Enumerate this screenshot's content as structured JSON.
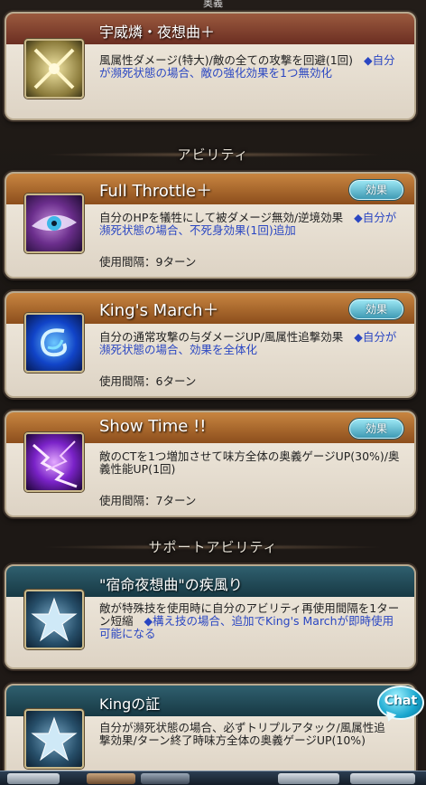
{
  "top_header": {
    "label": "奥義"
  },
  "ougi": {
    "title": "宇威燐・夜想曲＋",
    "icon": "crossed-swords-icon",
    "desc": "風属性ダメージ(特大)/敵の全ての攻撃を回避(1回)",
    "desc_hl": "◆自分が瀕死状態の場合、敵の強化効果を1つ無効化"
  },
  "ability_header": {
    "label": "アビリティ"
  },
  "abilities": [
    {
      "title": "Full Throttle＋",
      "icon": "eye-icon",
      "effect_label": "効果",
      "desc": "自分のHPを犠牲にして被ダメージ無効/逆境効果",
      "desc_hl": "◆自分が瀕死状態の場合、不死身効果(1回)追加",
      "cooldown": "使用間隔：9ターン"
    },
    {
      "title": "King's March＋",
      "icon": "blue-swirl-icon",
      "effect_label": "効果",
      "desc": "自分の通常攻撃の与ダメージUP/風属性追撃効果",
      "desc_hl": "◆自分が瀕死状態の場合、効果を全体化",
      "cooldown": "使用間隔：6ターン"
    },
    {
      "title": "Show Time !!",
      "icon": "purple-lightning-icon",
      "effect_label": "効果",
      "desc": "敵のCTを1つ増加させて味方全体の奥義ゲージUP(30%)/奥義性能UP(1回)",
      "desc_hl": "",
      "cooldown": "使用間隔：7ターン"
    }
  ],
  "support_header": {
    "label": "サポートアビリティ"
  },
  "supports": [
    {
      "title": "\"宿命夜想曲\"の疾風り",
      "icon": "star-icon",
      "desc": "敵が特殊技を使用時に自分のアビリティ再使用間隔を1ターン短縮",
      "desc_hl": "◆構え技の場合、追加でKing's Marchが即時使用可能になる"
    },
    {
      "title": "Kingの証",
      "icon": "star-icon",
      "desc": "自分が瀕死状態の場合、必ずトリプルアタック/風属性追撃効果/ターン終了時味方全体の奥義ゲージUP(10%)",
      "desc_hl": ""
    }
  ],
  "chat_button": {
    "label": "Chat"
  },
  "colors": {
    "highlight": "#2a46c2",
    "effect_button": "#3f9ab4",
    "red_bar": "#6b2e22",
    "orange_bar": "#8c4e1c",
    "teal_bar": "#173944"
  }
}
